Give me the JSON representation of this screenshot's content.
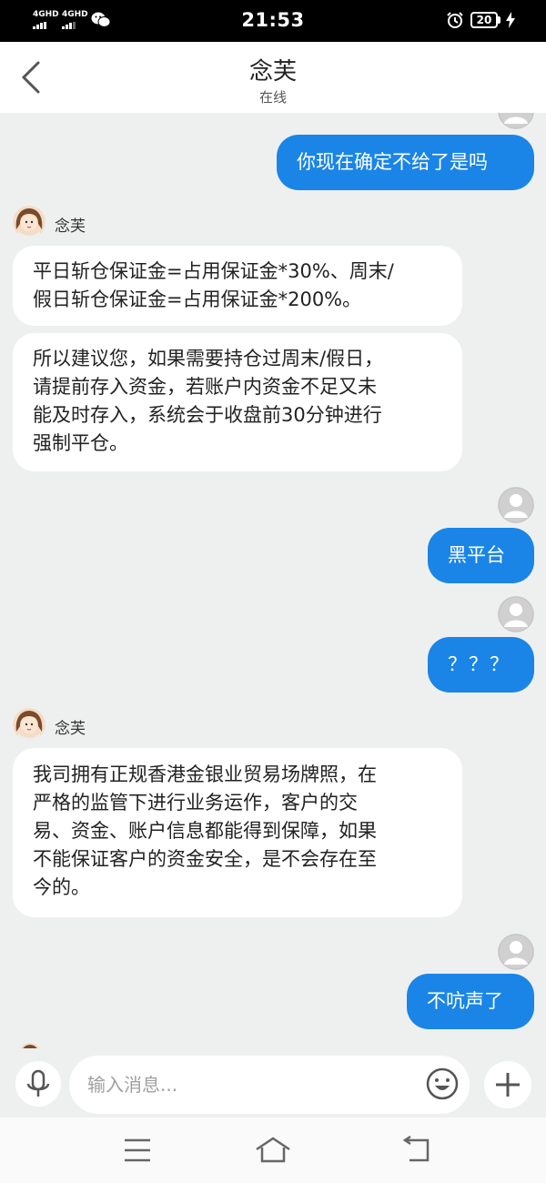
{
  "status_bar": {
    "time": "21:53",
    "signal_1": "4GHD",
    "signal_2": "4GHD",
    "battery": "20"
  },
  "header": {
    "title": "念芙",
    "subtitle": "在线"
  },
  "messages": [
    {
      "side": "out",
      "text": "你现在确定不给了是吗"
    },
    {
      "side": "in",
      "sender": "念芙",
      "text_lines": [
        "平日斩仓保证金=占用保证金*30%、周末/",
        "假日斩仓保证金=占用保证金*200%。"
      ]
    },
    {
      "side": "in",
      "text_lines": [
        "所以建议您，如果需要持仓过周末/假日，",
        "请提前存入资金，若账户内资金不足又未",
        "能及时存入，系统会于收盘前30分钟进行",
        "强制平仓。"
      ]
    },
    {
      "side": "out",
      "text": "黑平台"
    },
    {
      "side": "out",
      "text": "？？？"
    },
    {
      "side": "in",
      "sender": "念芙",
      "text_lines": [
        "我司拥有正规香港金银业贸易场牌照，在",
        "严格的监管下进行业务运作，客户的交",
        "易、资金、账户信息都能得到保障，如果",
        "不能保证客户的资金安全，是不会存在至",
        "今的。"
      ]
    },
    {
      "side": "out",
      "text": "不吭声了"
    }
  ],
  "input": {
    "placeholder": "输入消息..."
  },
  "colors": {
    "outgoing_bubble": "#1a85e6",
    "incoming_bubble": "#ffffff",
    "chat_background": "#eef0f0"
  }
}
